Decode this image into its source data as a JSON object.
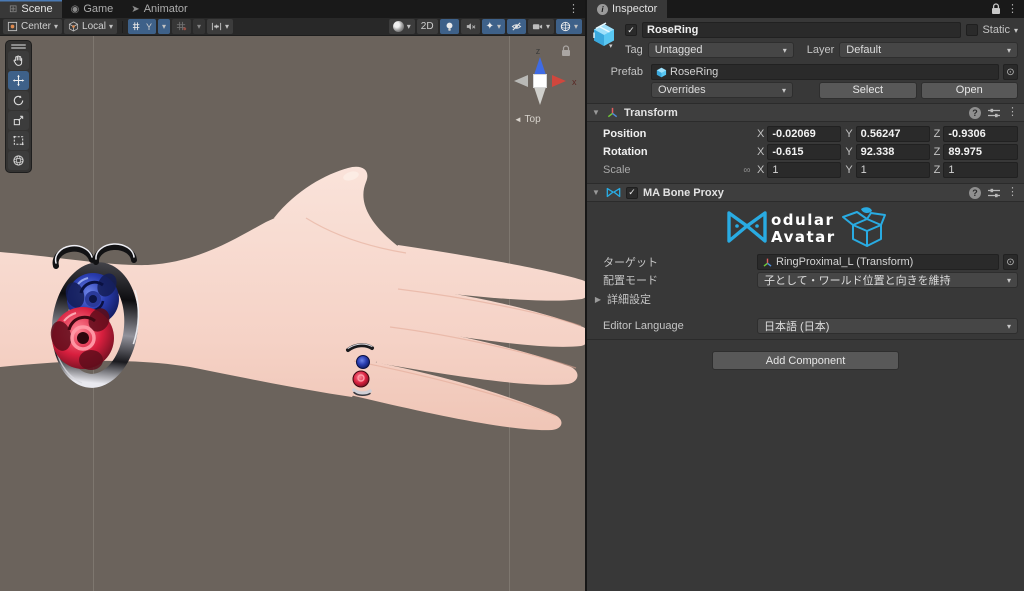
{
  "scene": {
    "tabs": {
      "scene": "Scene",
      "game": "Game",
      "animator": "Animator"
    },
    "toolbar": {
      "pivot": "Center",
      "space": "Local",
      "grid_axis": "Y",
      "mode_2d": "2D"
    },
    "gizmo": {
      "axis_z": "z",
      "axis_x": "x",
      "view": "Top",
      "view_arrow": "◄"
    }
  },
  "inspector": {
    "tab": "Inspector",
    "gameobject": {
      "name": "RoseRing",
      "static": "Static",
      "tag_label": "Tag",
      "tag": "Untagged",
      "layer_label": "Layer",
      "layer": "Default"
    },
    "prefab": {
      "label": "Prefab",
      "name": "RoseRing",
      "overrides": "Overrides",
      "select": "Select",
      "open": "Open"
    },
    "transform": {
      "title": "Transform",
      "rows": {
        "position": "Position",
        "rotation": "Rotation",
        "scale": "Scale"
      },
      "axis": {
        "x": "X",
        "y": "Y",
        "z": "Z"
      },
      "position": {
        "x": "-0.02069",
        "y": "0.56247",
        "z": "-0.9306"
      },
      "rotation": {
        "x": "-0.615",
        "y": "92.338",
        "z": "89.975"
      },
      "scale": {
        "x": "1",
        "y": "1",
        "z": "1"
      }
    },
    "ma": {
      "title": "MA Bone Proxy",
      "logo_top": "odular",
      "logo_bottom": "Avatar",
      "target_label": "ターゲット",
      "target": "RingProximal_L (Transform)",
      "mode_label": "配置モード",
      "mode": "子として・ワールド位置と向きを維持",
      "advanced": "詳細設定",
      "language_label": "Editor Language",
      "language": "日本語 (日本)"
    },
    "add_component": "Add Component"
  },
  "icons": {
    "kebab": "⋮",
    "caret": "▾",
    "foldout_open": "▼",
    "foldout_closed": "▶",
    "picker": "⊙",
    "check": "✓",
    "link": "∞",
    "help": "?",
    "sparkle": "✦",
    "info": "i"
  },
  "colors": {
    "accent": "#3e6189",
    "ma_blue": "#29abe2",
    "axis_x": "#d0453c",
    "axis_z": "#3f6be4",
    "viewport_bg": "#6b635c"
  }
}
